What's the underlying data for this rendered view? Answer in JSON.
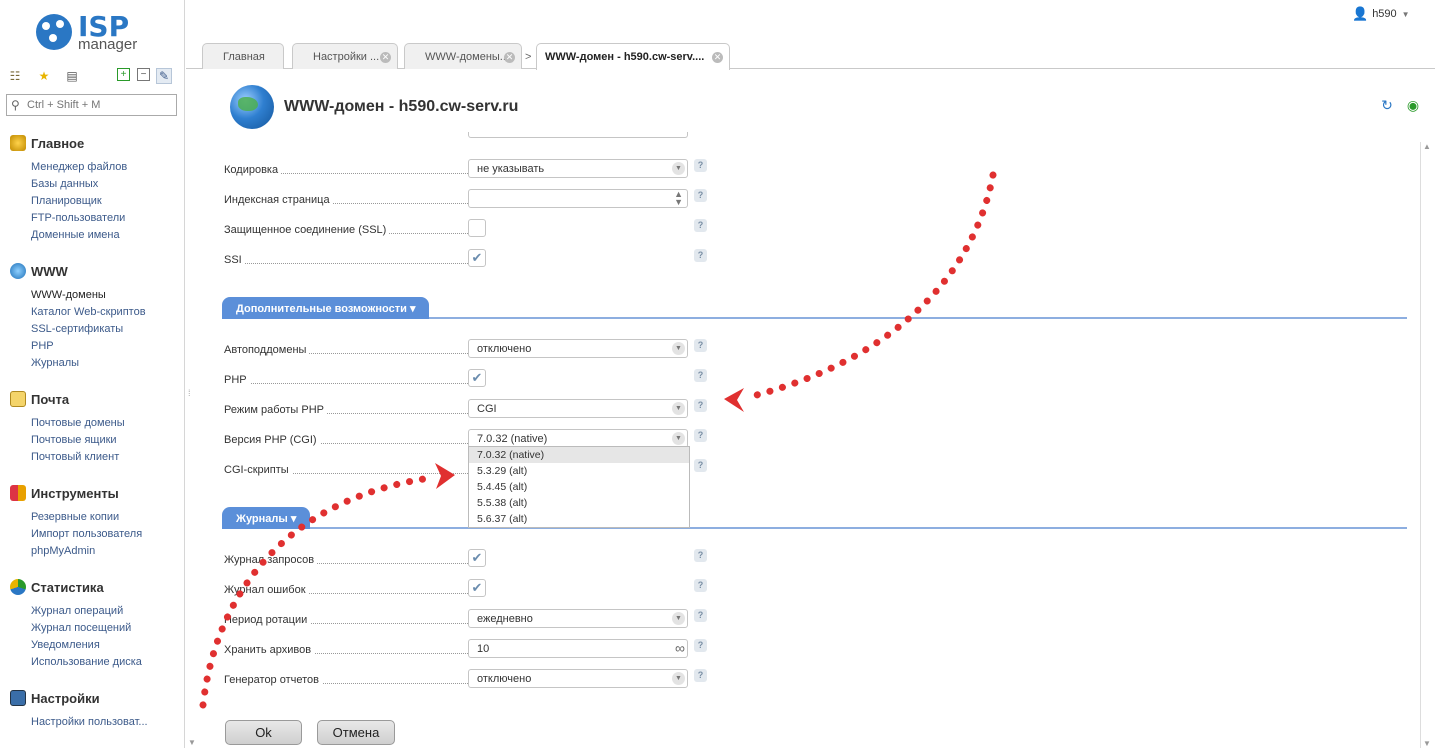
{
  "brand": {
    "isp": "ISP",
    "manager": "manager"
  },
  "user": {
    "name": "h590"
  },
  "search": {
    "placeholder": "Ctrl + Shift + M"
  },
  "sidebar": {
    "groups": [
      {
        "title": "Главное",
        "items": [
          "Менеджер файлов",
          "Базы данных",
          "Планировщик",
          "FTP-пользователи",
          "Доменные имена"
        ]
      },
      {
        "title": "WWW",
        "items": [
          "WWW-домены",
          "Каталог Web-скриптов",
          "SSL-сертификаты",
          "PHP",
          "Журналы"
        ]
      },
      {
        "title": "Почта",
        "items": [
          "Почтовые домены",
          "Почтовые ящики",
          "Почтовый клиент"
        ]
      },
      {
        "title": "Инструменты",
        "items": [
          "Резервные копии",
          "Импорт пользователя",
          "phpMyAdmin"
        ]
      },
      {
        "title": "Статистика",
        "items": [
          "Журнал операций",
          "Журнал посещений",
          "Уведомления",
          "Использование диска"
        ]
      },
      {
        "title": "Настройки",
        "items": [
          "Настройки пользоват..."
        ]
      }
    ]
  },
  "tabs": [
    {
      "label": "Главная"
    },
    {
      "label": "Настройки ..."
    },
    {
      "label": "WWW-домены..."
    },
    {
      "label": "WWW-домен - h590.cw-serv...."
    }
  ],
  "page": {
    "title": "WWW-домен - h590.cw-serv.ru"
  },
  "form": {
    "encoding": {
      "label": "Кодировка",
      "value": "не указывать"
    },
    "index_page": {
      "label": "Индексная страница",
      "value": ""
    },
    "ssl": {
      "label": "Защищенное соединение (SSL)",
      "checked": false
    },
    "ssi": {
      "label": "SSI",
      "checked": true
    },
    "section_extra": "Дополнительные возможности",
    "autosubdomains": {
      "label": "Автоподдомены",
      "value": "отключено"
    },
    "php": {
      "label": "PHP",
      "checked": true
    },
    "php_mode": {
      "label": "Режим работы PHP",
      "value": "CGI"
    },
    "php_version": {
      "label": "Версия PHP (CGI)",
      "value": "7.0.32 (native)",
      "options": [
        "7.0.32 (native)",
        "5.3.29 (alt)",
        "5.4.45 (alt)",
        "5.5.38 (alt)",
        "5.6.37 (alt)"
      ]
    },
    "cgi": {
      "label": "CGI-скрипты"
    },
    "section_logs": "Журналы",
    "access_log": {
      "label": "Журнал запросов",
      "checked": true
    },
    "error_log": {
      "label": "Журнал ошибок",
      "checked": true
    },
    "rotation": {
      "label": "Период ротации",
      "value": "ежедневно"
    },
    "keep_archives": {
      "label": "Хранить архивов",
      "value": "10"
    },
    "report_generator": {
      "label": "Генератор отчетов",
      "value": "отключено"
    },
    "help": "?"
  },
  "buttons": {
    "ok": "Ok",
    "cancel": "Отмена"
  },
  "colors": {
    "accent": "#2a77c4",
    "section": "#5b8fd9",
    "annotation": "#e03030"
  }
}
